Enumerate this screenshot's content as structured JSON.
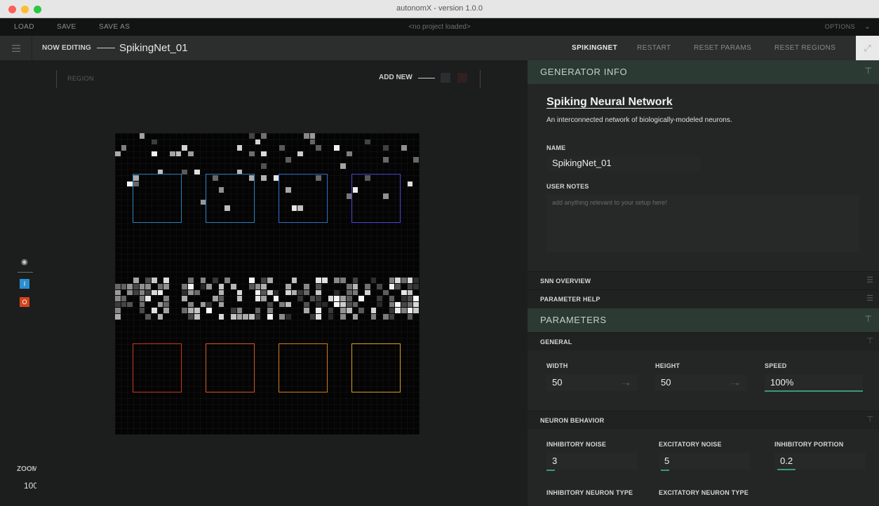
{
  "window": {
    "title": "autonomX - version 1.0.0",
    "traffic_light_colors": [
      "#fd5f57",
      "#febc2e",
      "#28c840"
    ]
  },
  "menubar": {
    "load": "LOAD",
    "save": "SAVE",
    "save_as": "SAVE AS",
    "project_status": "<no project loaded>",
    "options": "OPTIONS",
    "options_icon": "chevron-down-icon"
  },
  "editbar": {
    "menu_icon": "hamburger-icon",
    "now_editing_label": "NOW EDITING",
    "generator_name": "SpikingNet_01",
    "tabs": [
      "SPIKINGNET",
      "RESTART",
      "RESET PARAMS",
      "RESET REGIONS"
    ],
    "active_tab": "SPIKINGNET",
    "expand_icon": "expand-icon"
  },
  "canvas": {
    "region_label": "REGION",
    "add_new_label": "ADD NEW",
    "input_region_colors": [
      "#2a7fb8",
      "#2a80c0",
      "#2e6fc4",
      "#4a43d6"
    ],
    "output_region_colors": [
      "#c8361e",
      "#d1581e",
      "#d07c12",
      "#d4a012"
    ]
  },
  "tools": {
    "visibility_icon": "eye-icon",
    "input_button": "I",
    "output_button": "O",
    "input_color": "#2a8fd0",
    "output_color": "#d2441e",
    "zoom_label": "ZOOM",
    "zoom_value": "100"
  },
  "panel": {
    "generator_info": {
      "header": "GENERATOR INFO",
      "title": "Spiking Neural Network",
      "description": "An interconnected network of biologically-modeled neurons.",
      "name_label": "NAME",
      "name_value": "SpikingNet_01",
      "notes_label": "USER NOTES",
      "notes_placeholder": "add anything relevant to your setup here!"
    },
    "snn_overview": "SNN OVERVIEW",
    "parameter_help": "PARAMETER HELP",
    "parameters": {
      "header": "PARAMETERS",
      "general": {
        "label": "GENERAL",
        "width_label": "WIDTH",
        "width_value": "50",
        "height_label": "HEIGHT",
        "height_value": "50",
        "speed_label": "SPEED",
        "speed_value": "100%"
      },
      "neuron_behavior": {
        "label": "NEURON BEHAVIOR",
        "inhibitory_noise_label": "INHIBITORY NOISE",
        "inhibitory_noise_value": "3",
        "excitatory_noise_label": "EXCITATORY NOISE",
        "excitatory_noise_value": "5",
        "inhibitory_portion_label": "INHIBITORY PORTION",
        "inhibitory_portion_value": "0.2",
        "inhibitory_type_label": "INHIBITORY NEURON TYPE",
        "excitatory_type_label": "EXCITATORY NEURON TYPE"
      }
    },
    "accent_color": "#3a9a7e"
  }
}
